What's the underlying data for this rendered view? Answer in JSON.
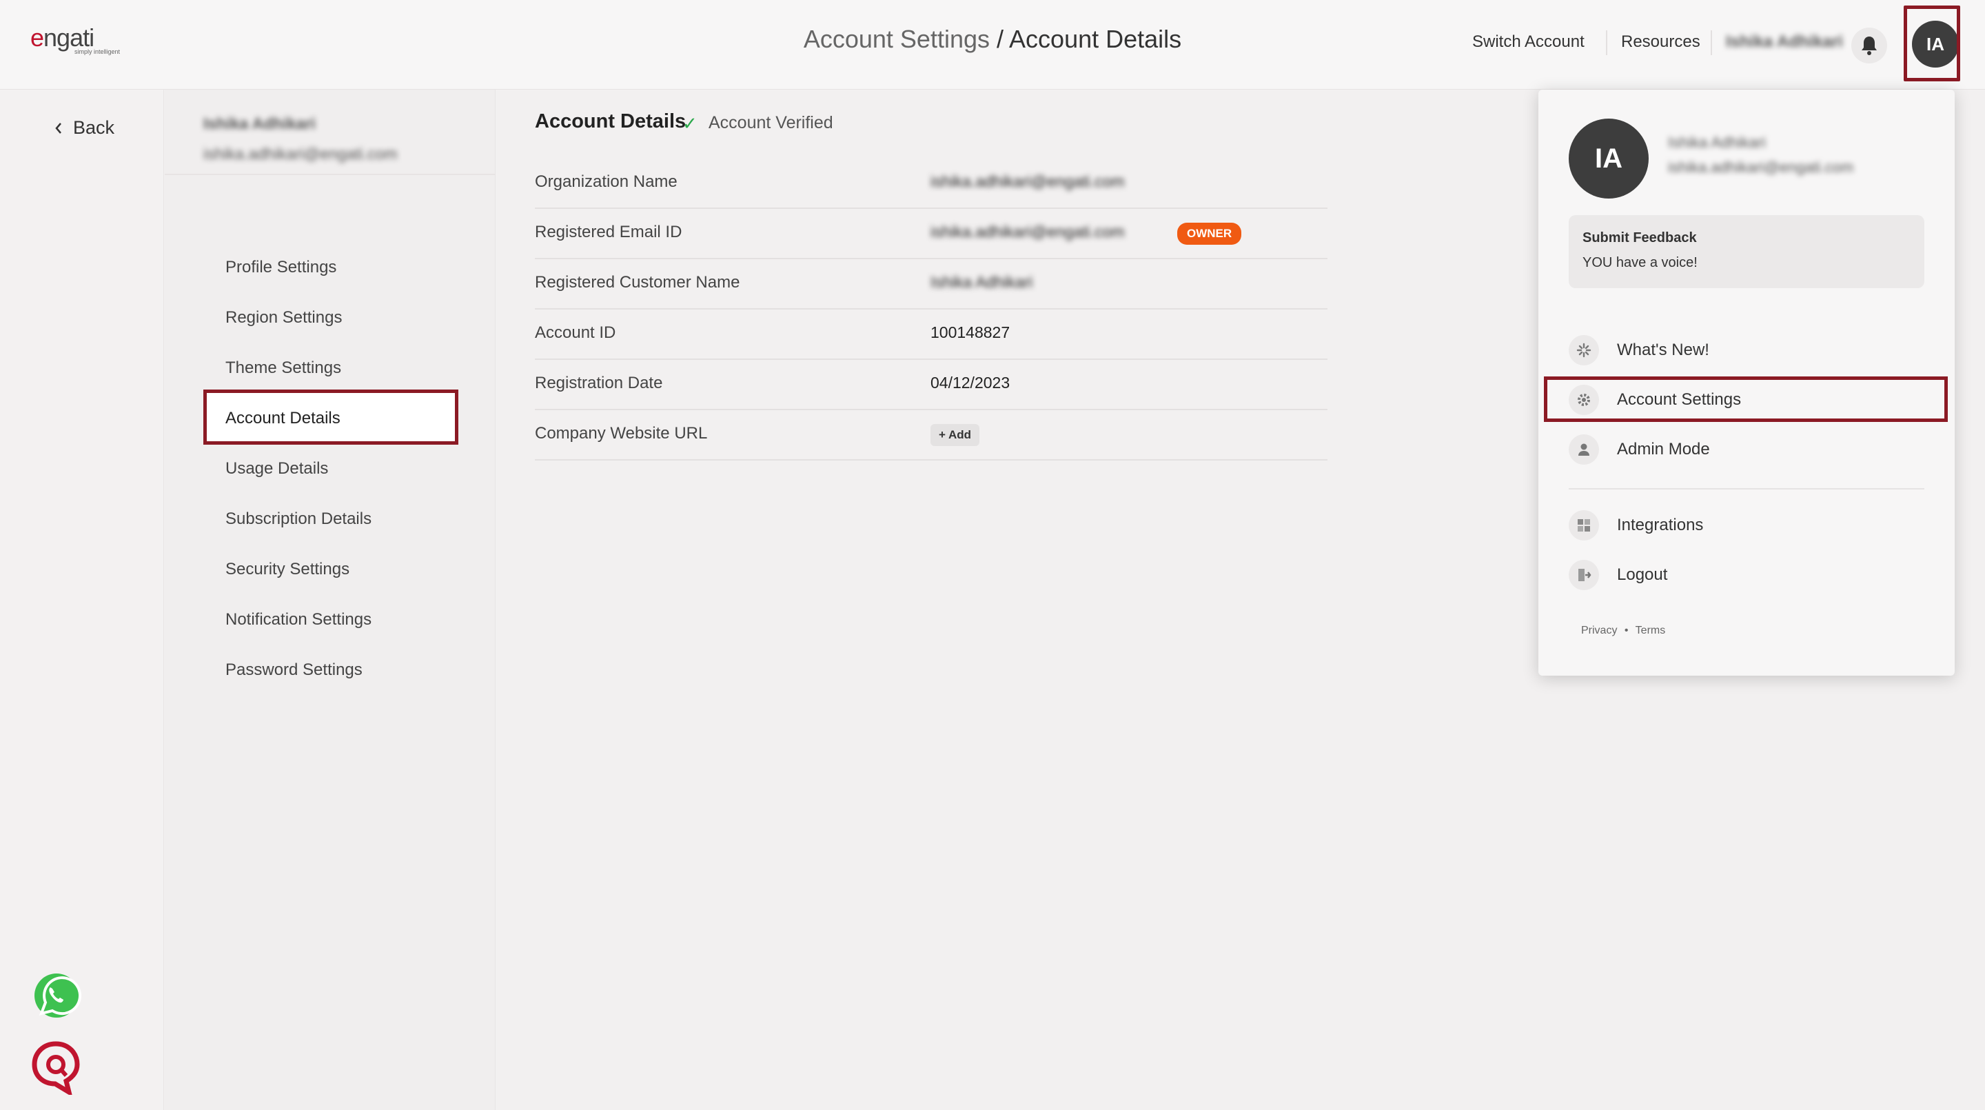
{
  "header": {
    "logo_text": "engati",
    "logo_tagline": "simply intelligent",
    "breadcrumb_parent": "Account Settings",
    "breadcrumb_sep": " / ",
    "breadcrumb_current": "Account Details",
    "switch_account": "Switch Account",
    "resources": "Resources",
    "user_name": "Ishika Adhikari",
    "avatar_initials": "IA"
  },
  "rail": {
    "back_label": "Back"
  },
  "nav": {
    "user_name": "Ishika Adhikari",
    "user_email": "ishika.adhikari@engati.com",
    "items": [
      {
        "label": "Profile Settings"
      },
      {
        "label": "Region Settings"
      },
      {
        "label": "Theme Settings"
      },
      {
        "label": "Account Details"
      },
      {
        "label": "Usage Details"
      },
      {
        "label": "Subscription Details"
      },
      {
        "label": "Security Settings"
      },
      {
        "label": "Notification Settings"
      },
      {
        "label": "Password Settings"
      }
    ],
    "active_index": 3
  },
  "main": {
    "title": "Account Details",
    "verified_check": "✓",
    "verified_label": "Account Verified",
    "rows": [
      {
        "label": "Organization Name",
        "value": "ishika.adhikari@engati.com"
      },
      {
        "label": "Registered Email ID",
        "value": "ishika.adhikari@engati.com",
        "badge": "OWNER"
      },
      {
        "label": "Registered Customer Name",
        "value": "Ishika Adhikari"
      },
      {
        "label": "Account ID",
        "value": "100148827"
      },
      {
        "label": "Registration Date",
        "value": "04/12/2023"
      },
      {
        "label": "Company Website URL",
        "button": "+ Add"
      }
    ]
  },
  "dropdown": {
    "avatar_initials": "IA",
    "user_name": "Ishika Adhikari",
    "user_email": "ishika.adhikari@engati.com",
    "feedback_title": "Submit Feedback",
    "feedback_subtitle": "YOU have a voice!",
    "items": [
      {
        "label": "What's New!",
        "icon": "sparkle-icon"
      },
      {
        "label": "Account Settings",
        "icon": "gear-icon"
      },
      {
        "label": "Admin Mode",
        "icon": "user-icon"
      },
      {
        "label": "Integrations",
        "icon": "grid-icon"
      },
      {
        "label": "Logout",
        "icon": "logout-icon"
      }
    ],
    "footer_privacy": "Privacy",
    "footer_dot": "•",
    "footer_terms": "Terms"
  },
  "colors": {
    "highlight": "#8b1a24",
    "owner_badge": "#f05a12",
    "verified": "#2aa84a",
    "avatar_bg": "#3d3d3d",
    "brand": "#c0152f"
  }
}
